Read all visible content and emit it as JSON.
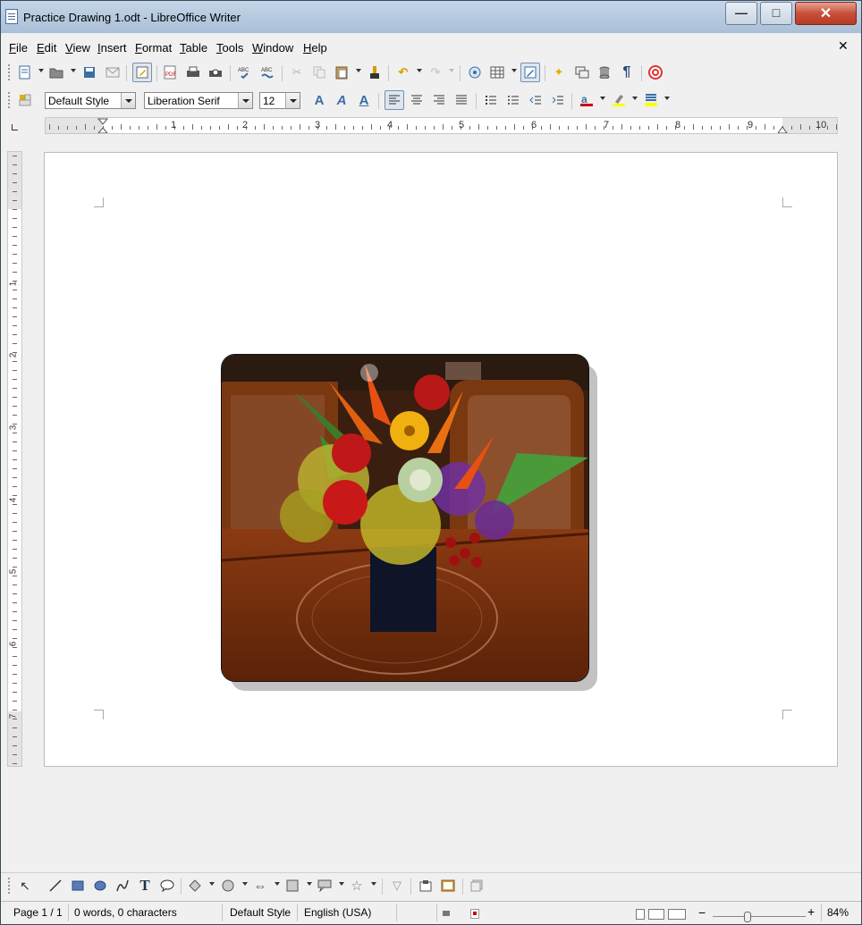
{
  "window": {
    "title": "Practice Drawing 1.odt - LibreOffice Writer"
  },
  "menu": [
    "File",
    "Edit",
    "View",
    "Insert",
    "Format",
    "Table",
    "Tools",
    "Window",
    "Help"
  ],
  "formatting": {
    "style": "Default Style",
    "font": "Liberation Serif",
    "size": "12"
  },
  "ruler": {
    "h_numbers": [
      "1",
      "2",
      "3",
      "4",
      "5",
      "6",
      "7",
      "8",
      "9",
      "10"
    ],
    "v_numbers": [
      "1",
      "2",
      "3",
      "4",
      "5",
      "6",
      "7"
    ]
  },
  "status": {
    "page": "Page 1 / 1",
    "words": "0 words, 0 characters",
    "style": "Default Style",
    "language": "English (USA)",
    "zoom": "84%"
  }
}
